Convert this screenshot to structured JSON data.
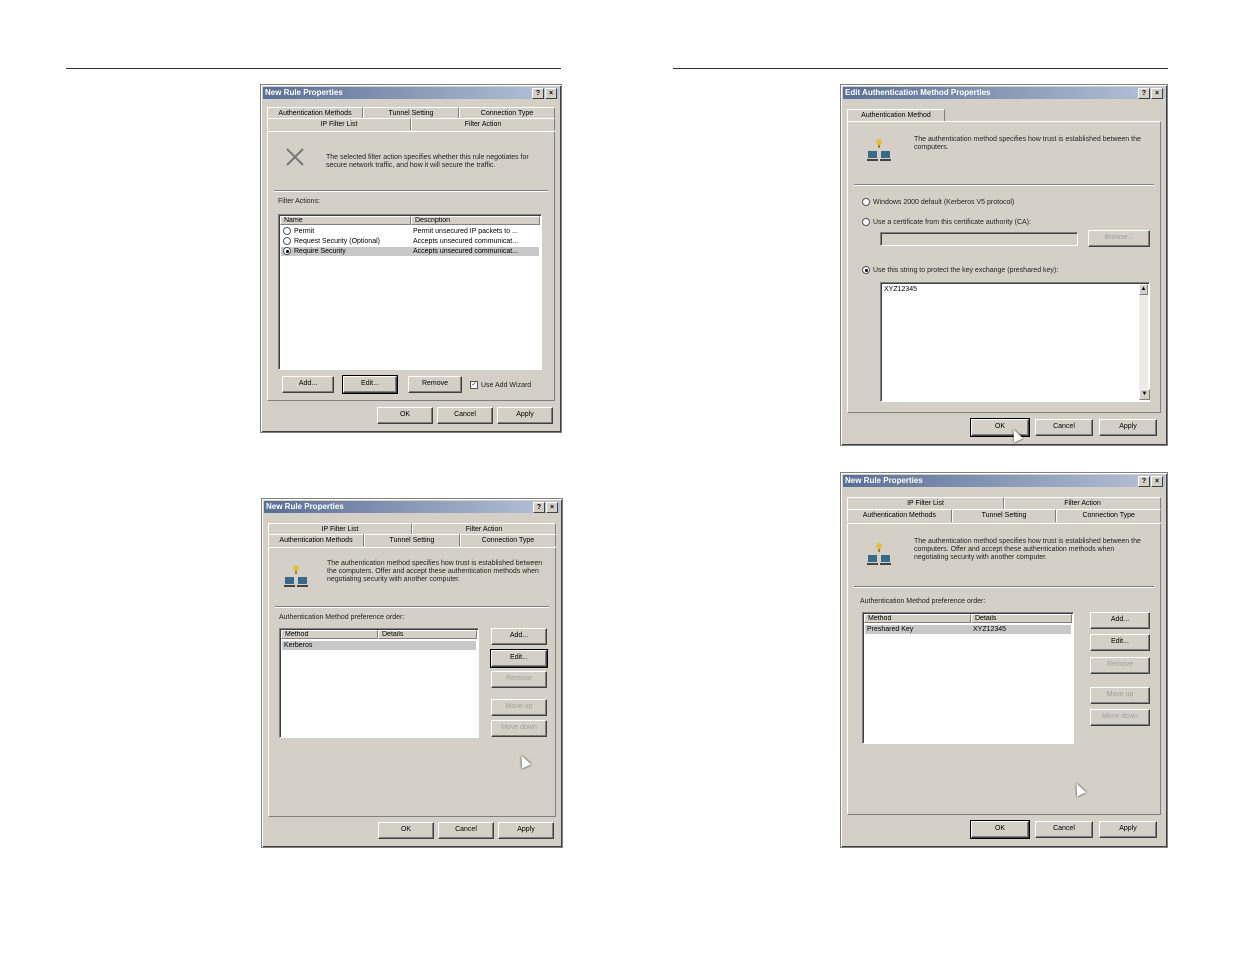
{
  "d1": {
    "title": "New Rule Properties",
    "help": "?",
    "close": "×",
    "tabs_back": [
      "Authentication Methods",
      "Tunnel Setting",
      "Connection Type"
    ],
    "tabs_front": [
      "IP Filter List",
      "Filter Action"
    ],
    "description": "The selected filter action specifies whether this rule negotiates for secure network traffic, and how it will secure the traffic.",
    "filter_actions_label": "Filter Actions:",
    "columns": [
      "Name",
      "Description"
    ],
    "rows": [
      {
        "name": "Permit",
        "desc": "Permit unsecured IP packets to ...",
        "selected": false
      },
      {
        "name": "Request Security (Optional)",
        "desc": "Accepts unsecured communicat...",
        "selected": false
      },
      {
        "name": "Require Security",
        "desc": "Accepts unsecured communicat...",
        "selected": true
      }
    ],
    "buttons": {
      "add": "Add...",
      "edit": "Edit...",
      "remove": "Remove"
    },
    "use_wizard": "Use Add Wizard",
    "footer": {
      "ok": "OK",
      "cancel": "Cancel",
      "apply": "Apply"
    }
  },
  "d2": {
    "title": "New Rule Properties",
    "help": "?",
    "close": "×",
    "tabs_back": [
      "IP Filter List",
      "Filter Action"
    ],
    "tabs_front": [
      "Authentication Methods",
      "Tunnel Setting",
      "Connection Type"
    ],
    "description": "The authentication method specifies how trust is established between the computers. Offer and accept these authentication methods when negotiating security with another computer.",
    "pref_label": "Authentication Method preference order:",
    "columns": [
      "Method",
      "Details"
    ],
    "rows": [
      {
        "method": "Kerberos",
        "details": ""
      }
    ],
    "side_buttons": [
      "Add...",
      "Edit...",
      "Remove",
      "Move up",
      "Move down"
    ],
    "footer": {
      "ok": "OK",
      "cancel": "Cancel",
      "apply": "Apply"
    }
  },
  "d3": {
    "title": "Edit Authentication Method Properties",
    "help": "?",
    "close": "×",
    "tab": "Authentication Method",
    "description": "The authentication method specifies how trust is established between the computers.",
    "option_kerberos": "Windows 2000 default (Kerberos V5 protocol)",
    "option_cert": "Use a certificate from this certificate authority (CA):",
    "browse": "Browse...",
    "option_psk": "Use this string to protect the key exchange (preshared key):",
    "psk_value": "XYZ12345",
    "footer": {
      "ok": "OK",
      "cancel": "Cancel",
      "apply": "Apply"
    }
  },
  "d4": {
    "title": "New Rule Properties",
    "help": "?",
    "close": "×",
    "tabs_back": [
      "IP Filter List",
      "Filter Action"
    ],
    "tabs_front": [
      "Authentication Methods",
      "Tunnel Setting",
      "Connection Type"
    ],
    "description": "The authentication method specifies how trust is established between the computers. Offer and accept these authentication methods when negotiating security with another computer.",
    "pref_label": "Authentication Method preference order:",
    "columns": [
      "Method",
      "Details"
    ],
    "rows": [
      {
        "method": "Preshared Key",
        "details": "XYZ12345"
      }
    ],
    "side_buttons": [
      "Add...",
      "Edit...",
      "Remove",
      "Move up",
      "Move down"
    ],
    "footer": {
      "ok": "OK",
      "cancel": "Cancel",
      "apply": "Apply"
    }
  }
}
